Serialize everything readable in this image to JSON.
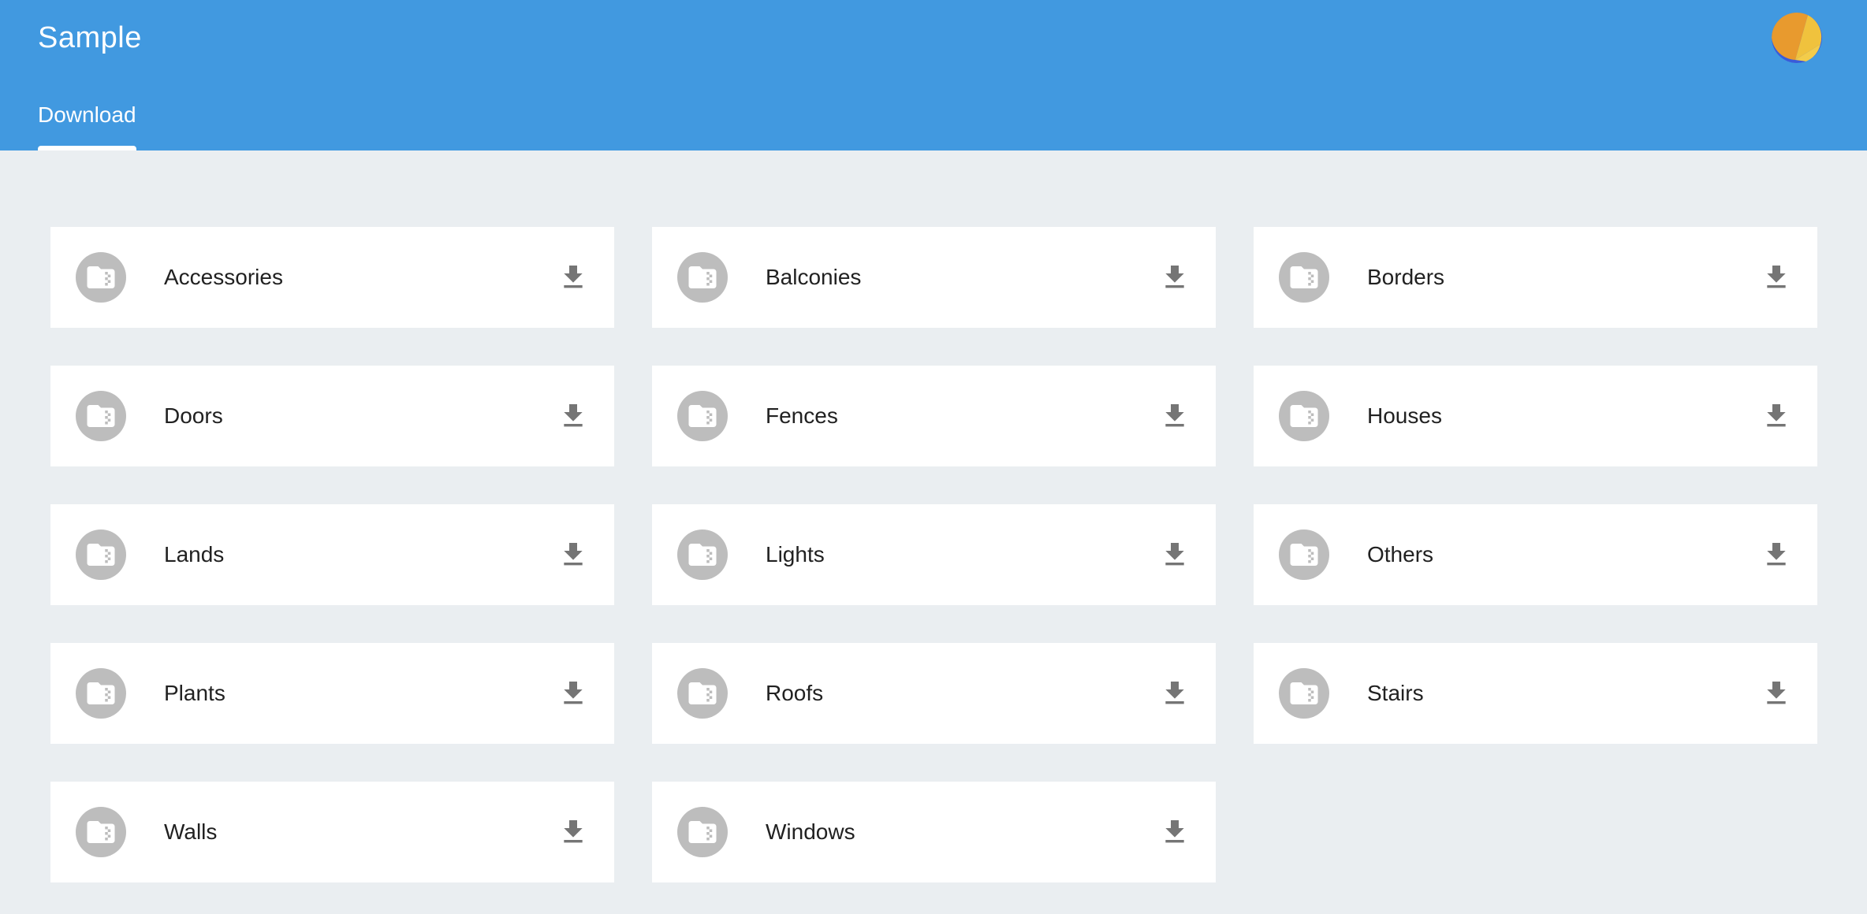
{
  "app": {
    "title": "Sample"
  },
  "tabs": [
    {
      "label": "Download",
      "active": true
    }
  ],
  "colors": {
    "appbar": "#4199e0",
    "background": "#eaeef1",
    "card": "#ffffff",
    "icon_circle": "#bdbdbd",
    "download_icon": "#757575"
  },
  "avatar": {
    "icon": "avatar-icon"
  },
  "items": [
    {
      "label": "Accessories",
      "icon": "folder-zip-icon",
      "action_icon": "download-icon"
    },
    {
      "label": "Balconies",
      "icon": "folder-zip-icon",
      "action_icon": "download-icon"
    },
    {
      "label": "Borders",
      "icon": "folder-zip-icon",
      "action_icon": "download-icon"
    },
    {
      "label": "Doors",
      "icon": "folder-zip-icon",
      "action_icon": "download-icon"
    },
    {
      "label": "Fences",
      "icon": "folder-zip-icon",
      "action_icon": "download-icon"
    },
    {
      "label": "Houses",
      "icon": "folder-zip-icon",
      "action_icon": "download-icon"
    },
    {
      "label": "Lands",
      "icon": "folder-zip-icon",
      "action_icon": "download-icon"
    },
    {
      "label": "Lights",
      "icon": "folder-zip-icon",
      "action_icon": "download-icon"
    },
    {
      "label": "Others",
      "icon": "folder-zip-icon",
      "action_icon": "download-icon"
    },
    {
      "label": "Plants",
      "icon": "folder-zip-icon",
      "action_icon": "download-icon"
    },
    {
      "label": "Roofs",
      "icon": "folder-zip-icon",
      "action_icon": "download-icon"
    },
    {
      "label": "Stairs",
      "icon": "folder-zip-icon",
      "action_icon": "download-icon"
    },
    {
      "label": "Walls",
      "icon": "folder-zip-icon",
      "action_icon": "download-icon"
    },
    {
      "label": "Windows",
      "icon": "folder-zip-icon",
      "action_icon": "download-icon"
    }
  ]
}
